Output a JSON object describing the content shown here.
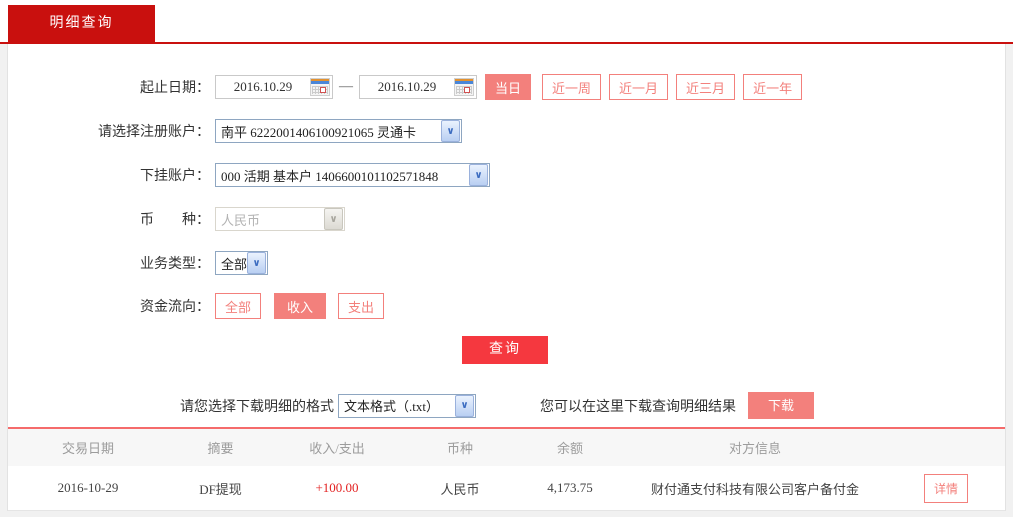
{
  "tab": {
    "label": "明细查询"
  },
  "form": {
    "date_label": "起止日期：",
    "date_from": "2016.10.29",
    "date_to": "2016.10.29",
    "date_separator": "—",
    "quick_ranges": [
      "当日",
      "近一周",
      "近一月",
      "近三月",
      "近一年"
    ],
    "registered_account": {
      "label": "请选择注册账户：",
      "value": "南平 6222001406100921065 灵通卡"
    },
    "sub_account": {
      "label": "下挂账户：",
      "value": "000 活期 基本户 1406600101102571848"
    },
    "currency": {
      "label": "币　　种：",
      "value": "人民币"
    },
    "business_type": {
      "label": "业务类型：",
      "value": "全部"
    },
    "flow": {
      "label": "资金流向：",
      "options": [
        "全部",
        "收入",
        "支出"
      ],
      "selected": "收入"
    },
    "query_button": "查询"
  },
  "download": {
    "format_label": "请您选择下载明细的格式",
    "format_value": "文本格式（.txt）",
    "hint": "您可以在这里下载查询明细结果",
    "button_label": "下载"
  },
  "table": {
    "headers": [
      "交易日期",
      "摘要",
      "收入/支出",
      "币种",
      "余额",
      "对方信息"
    ],
    "rows": [
      {
        "date": "2016-10-29",
        "summary": "DF提现",
        "amount": "+100.00",
        "currency": "人民币",
        "balance": "4,173.75",
        "counterparty": "财付通支付科技有限公司客户备付金",
        "action": "详情"
      }
    ]
  },
  "colors": {
    "tab_red": "#c9100e",
    "query_red": "#f5383f",
    "accent_salmon": "#f3807c",
    "amount_red": "#e32222",
    "divider_pink": "#f56b6b"
  }
}
